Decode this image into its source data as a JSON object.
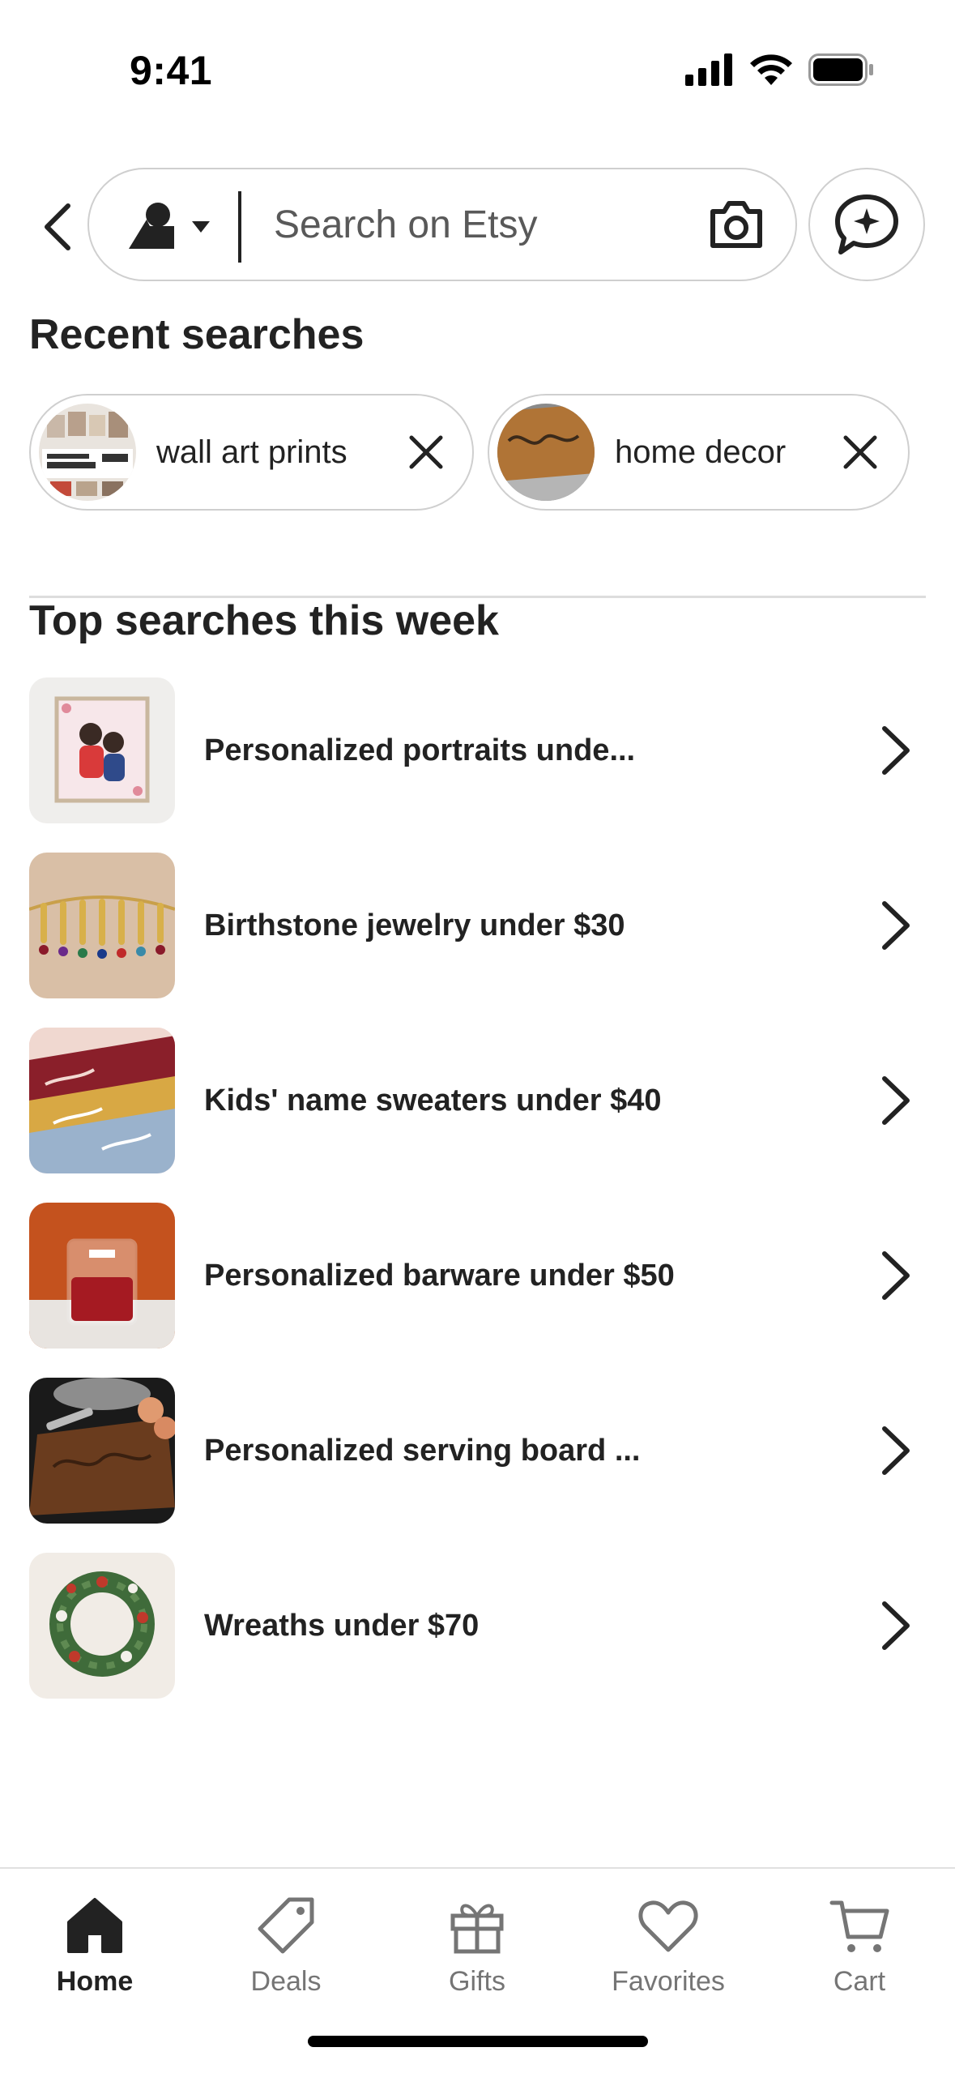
{
  "status_bar": {
    "time": "9:41"
  },
  "search": {
    "placeholder": "Search on Etsy"
  },
  "recent": {
    "title": "Recent searches",
    "chips": [
      {
        "label": "wall art prints",
        "thumb_icon": "wall-art-bundle-thumbnail"
      },
      {
        "label": "home decor",
        "thumb_icon": "doormat-thumbnail"
      }
    ]
  },
  "top": {
    "title": "Top searches this week",
    "items": [
      {
        "label": "Personalized portraits unde..."
      },
      {
        "label": "Birthstone jewelry under $30"
      },
      {
        "label": "Kids' name sweaters under $40"
      },
      {
        "label": "Personalized barware under $50"
      },
      {
        "label": "Personalized serving board ..."
      },
      {
        "label": "Wreaths under $70"
      }
    ]
  },
  "tabs": [
    {
      "label": "Home",
      "icon": "home-icon",
      "active": true
    },
    {
      "label": "Deals",
      "icon": "tag-icon",
      "active": false
    },
    {
      "label": "Gifts",
      "icon": "gift-icon",
      "active": false
    },
    {
      "label": "Favorites",
      "icon": "heart-icon",
      "active": false
    },
    {
      "label": "Cart",
      "icon": "cart-icon",
      "active": false
    }
  ],
  "colors": {
    "text": "#222222",
    "muted": "#757575",
    "border": "#cfcfcf"
  }
}
